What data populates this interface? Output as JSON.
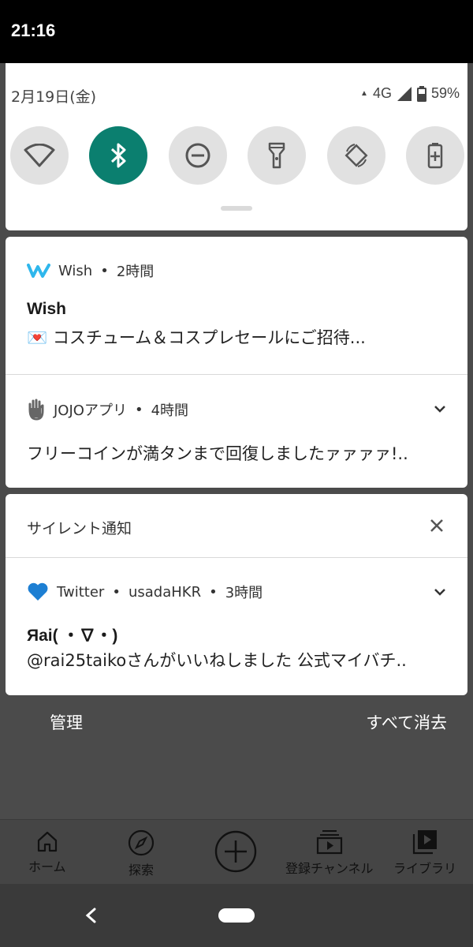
{
  "status_bar": {
    "time": "21:16"
  },
  "quick_settings": {
    "date": "2月19日(金)",
    "network": "4G",
    "battery": "59%",
    "tiles": [
      {
        "icon": "wifi-icon",
        "active": false
      },
      {
        "icon": "bluetooth-icon",
        "active": true
      },
      {
        "icon": "do-not-disturb-icon",
        "active": false
      },
      {
        "icon": "flashlight-icon",
        "active": false
      },
      {
        "icon": "auto-rotate-icon",
        "active": false
      },
      {
        "icon": "battery-saver-icon",
        "active": false
      }
    ]
  },
  "notifications": {
    "wish": {
      "app": "Wish",
      "time": "2時間",
      "title": "Wish",
      "body": "💌 コスチューム＆コスプレセールにご招待..."
    },
    "jojo": {
      "app": "JOJOアプリ",
      "time": "4時間",
      "body": "フリーコインが満タンまで回復しましたァァァァ!.."
    },
    "silent": {
      "header": "サイレント通知",
      "twitter": {
        "app": "Twitter",
        "account": "usadaHKR",
        "time": "3時間",
        "title": "Яai( ・∇・)",
        "body": "@rai25taikoさんがいいねしました 公式マイバチ.."
      }
    }
  },
  "actions": {
    "manage": "管理",
    "clear_all": "すべて消去"
  },
  "app_nav": {
    "items": [
      {
        "label": "ホーム",
        "icon": "home-icon"
      },
      {
        "label": "探索",
        "icon": "explore-icon"
      },
      {
        "label": "",
        "icon": "add-icon"
      },
      {
        "label": "登録チャンネル",
        "icon": "subscriptions-icon"
      },
      {
        "label": "ライブラリ",
        "icon": "library-icon"
      }
    ]
  },
  "separators": {
    "dot": "•"
  }
}
